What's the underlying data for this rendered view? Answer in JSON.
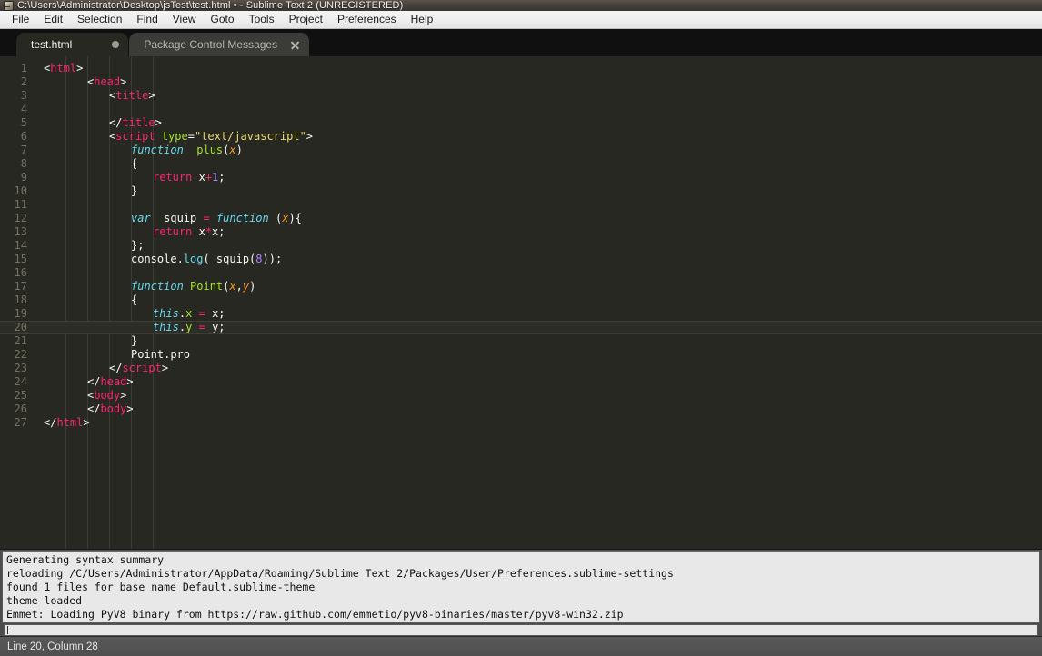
{
  "window": {
    "title": "C:\\Users\\Administrator\\Desktop\\jsTest\\test.html • - Sublime Text 2 (UNREGISTERED)",
    "app_icon": "sublime-text-icon"
  },
  "menubar": {
    "items": [
      {
        "label": "File"
      },
      {
        "label": "Edit"
      },
      {
        "label": "Selection"
      },
      {
        "label": "Find"
      },
      {
        "label": "View"
      },
      {
        "label": "Goto"
      },
      {
        "label": "Tools"
      },
      {
        "label": "Project"
      },
      {
        "label": "Preferences"
      },
      {
        "label": "Help"
      }
    ]
  },
  "tabs": [
    {
      "label": "test.html",
      "active": true,
      "modified": true,
      "closable": false
    },
    {
      "label": "Package Control Messages",
      "active": false,
      "modified": false,
      "closable": true
    }
  ],
  "editor": {
    "theme": "Monokai",
    "colors": {
      "background": "#272822",
      "foreground": "#f8f8f2",
      "gutter": "#75715e",
      "current_line": "#2c2d26",
      "tag": "#f92672",
      "attribute": "#a6e22e",
      "string": "#e6db74",
      "keyword": "#66d9ef",
      "function": "#a6e22e",
      "parameter": "#fd971f",
      "number": "#ae81ff",
      "operator": "#f92672"
    },
    "current_line_number": 20,
    "lines": [
      {
        "n": 1,
        "indent": 0,
        "tokens": [
          {
            "t": "punct",
            "v": "<"
          },
          {
            "t": "tag",
            "v": "html"
          },
          {
            "t": "punct",
            "v": ">"
          }
        ]
      },
      {
        "n": 2,
        "indent": 2,
        "tokens": [
          {
            "t": "punct",
            "v": "<"
          },
          {
            "t": "tag",
            "v": "head"
          },
          {
            "t": "punct",
            "v": ">"
          }
        ]
      },
      {
        "n": 3,
        "indent": 3,
        "tokens": [
          {
            "t": "punct",
            "v": "<"
          },
          {
            "t": "tag",
            "v": "title"
          },
          {
            "t": "punct",
            "v": ">"
          }
        ]
      },
      {
        "n": 4,
        "indent": 0,
        "tokens": []
      },
      {
        "n": 5,
        "indent": 3,
        "tokens": [
          {
            "t": "punct",
            "v": "</"
          },
          {
            "t": "tag",
            "v": "title"
          },
          {
            "t": "punct",
            "v": ">"
          }
        ]
      },
      {
        "n": 6,
        "indent": 3,
        "tokens": [
          {
            "t": "punct",
            "v": "<"
          },
          {
            "t": "tag",
            "v": "script"
          },
          {
            "t": "plain",
            "v": " "
          },
          {
            "t": "attr",
            "v": "type"
          },
          {
            "t": "punct",
            "v": "="
          },
          {
            "t": "string",
            "v": "\"text/javascript\""
          },
          {
            "t": "punct",
            "v": ">"
          }
        ]
      },
      {
        "n": 7,
        "indent": 4,
        "tokens": [
          {
            "t": "kw",
            "v": "function"
          },
          {
            "t": "plain",
            "v": "  "
          },
          {
            "t": "fn",
            "v": "plus"
          },
          {
            "t": "punct",
            "v": "("
          },
          {
            "t": "param",
            "v": "x"
          },
          {
            "t": "punct",
            "v": ")"
          }
        ]
      },
      {
        "n": 8,
        "indent": 4,
        "tokens": [
          {
            "t": "punct",
            "v": "{"
          }
        ]
      },
      {
        "n": 9,
        "indent": 5,
        "tokens": [
          {
            "t": "op",
            "v": "return"
          },
          {
            "t": "plain",
            "v": " x"
          },
          {
            "t": "op",
            "v": "+"
          },
          {
            "t": "num",
            "v": "1"
          },
          {
            "t": "plain",
            "v": ";"
          }
        ]
      },
      {
        "n": 10,
        "indent": 4,
        "tokens": [
          {
            "t": "punct",
            "v": "}"
          }
        ]
      },
      {
        "n": 11,
        "indent": 0,
        "tokens": []
      },
      {
        "n": 12,
        "indent": 4,
        "tokens": [
          {
            "t": "kw",
            "v": "var"
          },
          {
            "t": "plain",
            "v": "  squip "
          },
          {
            "t": "op",
            "v": "="
          },
          {
            "t": "plain",
            "v": " "
          },
          {
            "t": "kw",
            "v": "function"
          },
          {
            "t": "plain",
            "v": " "
          },
          {
            "t": "punct",
            "v": "("
          },
          {
            "t": "param",
            "v": "x"
          },
          {
            "t": "punct",
            "v": "){"
          }
        ]
      },
      {
        "n": 13,
        "indent": 5,
        "tokens": [
          {
            "t": "op",
            "v": "return"
          },
          {
            "t": "plain",
            "v": " x"
          },
          {
            "t": "op",
            "v": "*"
          },
          {
            "t": "plain",
            "v": "x;"
          }
        ]
      },
      {
        "n": 14,
        "indent": 4,
        "tokens": [
          {
            "t": "punct",
            "v": "};"
          }
        ]
      },
      {
        "n": 15,
        "indent": 4,
        "tokens": [
          {
            "t": "plain",
            "v": "console."
          },
          {
            "t": "prop",
            "v": "log"
          },
          {
            "t": "plain",
            "v": "( squip("
          },
          {
            "t": "num",
            "v": "8"
          },
          {
            "t": "plain",
            "v": "));"
          }
        ]
      },
      {
        "n": 16,
        "indent": 0,
        "tokens": []
      },
      {
        "n": 17,
        "indent": 4,
        "tokens": [
          {
            "t": "kw",
            "v": "function"
          },
          {
            "t": "plain",
            "v": " "
          },
          {
            "t": "fn",
            "v": "Point"
          },
          {
            "t": "punct",
            "v": "("
          },
          {
            "t": "param",
            "v": "x"
          },
          {
            "t": "punct",
            "v": ","
          },
          {
            "t": "param",
            "v": "y"
          },
          {
            "t": "punct",
            "v": ")"
          }
        ]
      },
      {
        "n": 18,
        "indent": 4,
        "tokens": [
          {
            "t": "punct",
            "v": "{"
          }
        ]
      },
      {
        "n": 19,
        "indent": 5,
        "tokens": [
          {
            "t": "kw",
            "v": "this"
          },
          {
            "t": "plain",
            "v": "."
          },
          {
            "t": "fn",
            "v": "x"
          },
          {
            "t": "plain",
            "v": " "
          },
          {
            "t": "op",
            "v": "="
          },
          {
            "t": "plain",
            "v": " x;"
          }
        ]
      },
      {
        "n": 20,
        "indent": 5,
        "tokens": [
          {
            "t": "kw",
            "v": "this"
          },
          {
            "t": "plain",
            "v": "."
          },
          {
            "t": "fn",
            "v": "y"
          },
          {
            "t": "plain",
            "v": " "
          },
          {
            "t": "op",
            "v": "="
          },
          {
            "t": "plain",
            "v": " y;"
          }
        ]
      },
      {
        "n": 21,
        "indent": 4,
        "tokens": [
          {
            "t": "punct",
            "v": "}"
          }
        ]
      },
      {
        "n": 22,
        "indent": 4,
        "tokens": [
          {
            "t": "plain",
            "v": "Point.pro"
          }
        ]
      },
      {
        "n": 23,
        "indent": 3,
        "tokens": [
          {
            "t": "punct",
            "v": "</"
          },
          {
            "t": "tag",
            "v": "script"
          },
          {
            "t": "punct",
            "v": ">"
          }
        ]
      },
      {
        "n": 24,
        "indent": 2,
        "tokens": [
          {
            "t": "punct",
            "v": "</"
          },
          {
            "t": "tag",
            "v": "head"
          },
          {
            "t": "punct",
            "v": ">"
          }
        ]
      },
      {
        "n": 25,
        "indent": 2,
        "tokens": [
          {
            "t": "punct",
            "v": "<"
          },
          {
            "t": "tag",
            "v": "body"
          },
          {
            "t": "punct",
            "v": ">"
          }
        ]
      },
      {
        "n": 26,
        "indent": 2,
        "tokens": [
          {
            "t": "punct",
            "v": "</"
          },
          {
            "t": "tag",
            "v": "body"
          },
          {
            "t": "punct",
            "v": ">"
          }
        ]
      },
      {
        "n": 27,
        "indent": 0,
        "tokens": [
          {
            "t": "punct",
            "v": "</"
          },
          {
            "t": "tag",
            "v": "html"
          },
          {
            "t": "punct",
            "v": ">"
          }
        ]
      }
    ]
  },
  "console": {
    "lines": [
      "Generating syntax summary",
      "reloading /C/Users/Administrator/AppData/Roaming/Sublime Text 2/Packages/User/Preferences.sublime-settings",
      "found 1 files for base name Default.sublime-theme",
      "theme loaded",
      "Emmet: Loading PyV8 binary from https://raw.github.com/emmetio/pyv8-binaries/master/pyv8-win32.zip"
    ],
    "input_value": ""
  },
  "statusbar": {
    "position": "Line 20, Column 28",
    "right_items": []
  }
}
